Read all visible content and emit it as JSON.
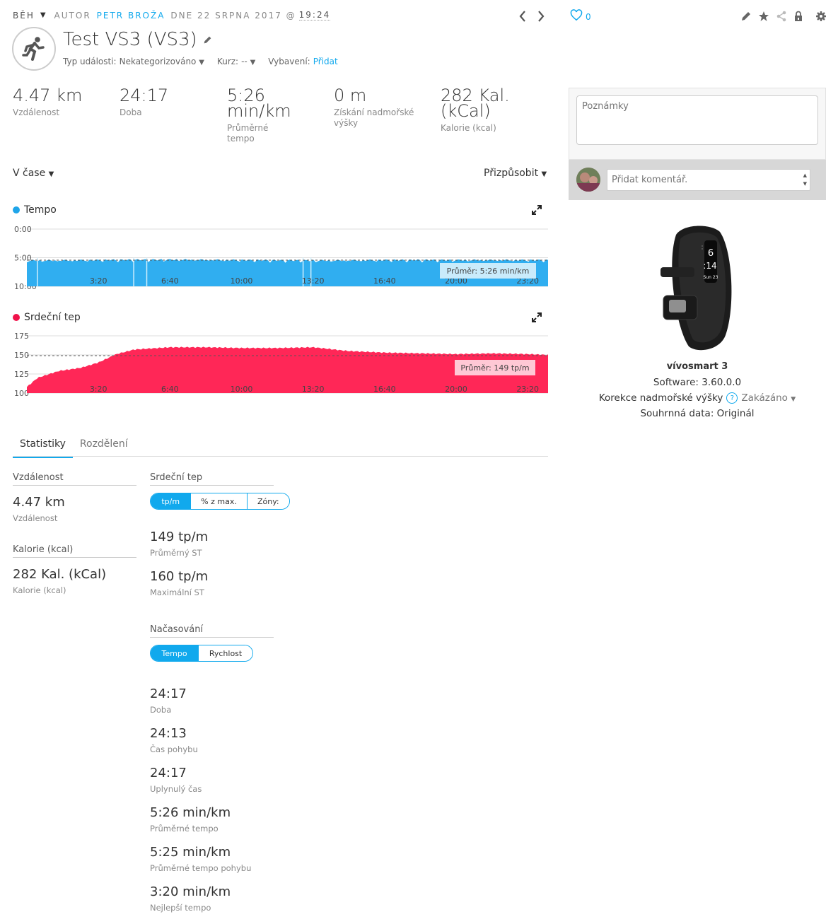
{
  "header": {
    "activity_type": "BĚH",
    "author_prefix": "AUTOR",
    "author_name": "PETR BROŽA",
    "date_text": "DNE 22 SRPNA 2017 @",
    "time": "19:24",
    "likes": "0"
  },
  "activity": {
    "title": "Test VS3 (VS3)",
    "event_type_label": "Typ události:",
    "event_type_value": "Nekategorizováno",
    "course_label": "Kurz:",
    "course_value": "--",
    "gear_label": "Vybavení:",
    "gear_value": "Přidat"
  },
  "summary": [
    {
      "value": "4.47 km",
      "label": "Vzdálenost"
    },
    {
      "value": "24:17",
      "label": "Doba"
    },
    {
      "value": "5:26 min/km",
      "label": "Průměrné tempo"
    },
    {
      "value": "0 m",
      "label": "Získání nadmořské výšky"
    },
    {
      "value": "282 Kal. (kCal)",
      "label": "Kalorie (kcal)"
    }
  ],
  "controls": {
    "xaxis_select": "V čase",
    "customize": "Přizpůsobit"
  },
  "charts": {
    "pace": {
      "title": "Tempo",
      "avg_label": "Průměr: 5:26 min/km",
      "y_ticks": [
        "0:00",
        "5:00",
        "10:00"
      ],
      "x_ticks": [
        "3:20",
        "6:40",
        "10:00",
        "13:20",
        "16:40",
        "20:00",
        "23:20"
      ],
      "color": "#30aef0"
    },
    "hr": {
      "title": "Srdeční tep",
      "avg_label": "Průměr: 149 tp/m",
      "y_ticks": [
        "175",
        "150",
        "125",
        "100"
      ],
      "x_ticks": [
        "3:20",
        "6:40",
        "10:00",
        "13:20",
        "16:40",
        "20:00",
        "23:20"
      ],
      "color": "#ff2757"
    }
  },
  "chart_data": [
    {
      "type": "area",
      "title": "Tempo",
      "xlabel": "",
      "ylabel": "",
      "x_unit": "min:s",
      "y_unit": "min/km (inverted)",
      "ylim": [
        "10:00",
        "0:00"
      ],
      "x": [
        "0:00",
        "3:20",
        "6:40",
        "10:00",
        "13:20",
        "16:40",
        "20:00",
        "23:20",
        "24:17"
      ],
      "values": [
        "5:30",
        "5:25",
        "5:20",
        "5:25",
        "5:30",
        "5:25",
        "5:25",
        "5:25",
        "5:26"
      ],
      "average": "5:26"
    },
    {
      "type": "area",
      "title": "Srdeční tep",
      "xlabel": "",
      "ylabel": "",
      "ylim": [
        100,
        175
      ],
      "x": [
        "0:00",
        "0:30",
        "1:30",
        "2:30",
        "3:20",
        "4:10",
        "5:00",
        "6:40",
        "8:20",
        "10:00",
        "11:40",
        "13:20",
        "15:00",
        "16:40",
        "18:20",
        "20:00",
        "21:40",
        "23:20",
        "24:17"
      ],
      "values": [
        108,
        120,
        129,
        133,
        140,
        151,
        157,
        160,
        160,
        159,
        159,
        160,
        155,
        153,
        152,
        151,
        152,
        151,
        150
      ],
      "average": 149
    }
  ],
  "stats": {
    "tabs": [
      "Statistiky",
      "Rozdělení"
    ],
    "distance": {
      "title": "Vzdálenost",
      "value": "4.47 km",
      "label": "Vzdálenost"
    },
    "calories": {
      "title": "Kalorie (kcal)",
      "value": "282 Kal. (kCal)",
      "label": "Kalorie (kcal)"
    },
    "heart": {
      "title": "Srdeční tep",
      "toggle": [
        "tp/m",
        "% z max.",
        "Zóny:"
      ],
      "avg_value": "149 tp/m",
      "avg_label": "Průměrný ST",
      "max_value": "160 tp/m",
      "max_label": "Maximální ST"
    },
    "timing": {
      "title": "Načasování",
      "toggle": [
        "Tempo",
        "Rychlost"
      ],
      "items": [
        {
          "value": "24:17",
          "label": "Doba"
        },
        {
          "value": "24:13",
          "label": "Čas pohybu"
        },
        {
          "value": "24:17",
          "label": "Uplynulý čas"
        },
        {
          "value": "5:26 min/km",
          "label": "Průměrné tempo"
        },
        {
          "value": "5:25 min/km",
          "label": "Průměrné tempo pohybu"
        },
        {
          "value": "3:20 min/km",
          "label": "Nejlepší tempo"
        }
      ]
    }
  },
  "sidebar": {
    "notes_placeholder": "Poznámky",
    "comment_placeholder": "Přidat komentář.",
    "device_name": "vívosmart 3",
    "software": "Software: 3.60.0.0",
    "elev_label": "Korekce nadmořské výšky",
    "elev_value": "Zakázáno",
    "summary_label": "Souhrnná data: Originál",
    "watch_time_1": "6",
    "watch_time_2": ":14",
    "watch_date": "Sun 23"
  }
}
